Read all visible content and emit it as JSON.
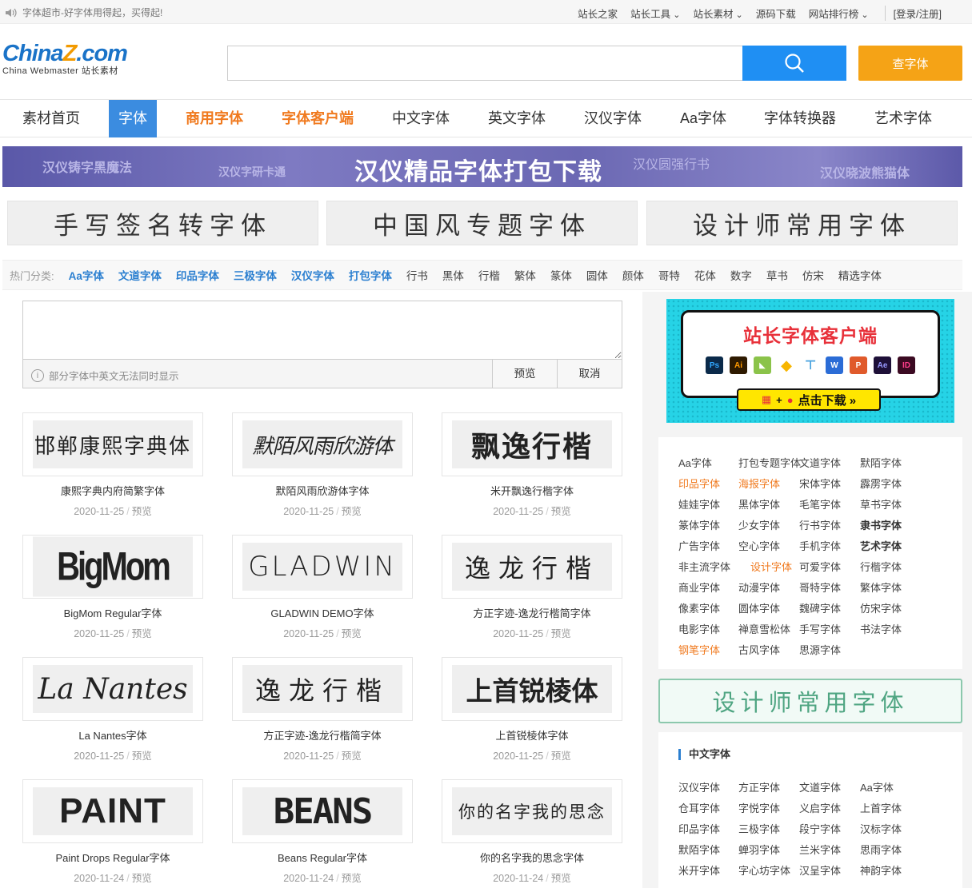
{
  "topbar": {
    "notice": "字体超市-好字体用得起，买得起!",
    "links": [
      "站长之家",
      "站长工具",
      "站长素材",
      "源码下载",
      "网站排行榜"
    ],
    "login": "[登录/注册]"
  },
  "logo": {
    "part1": "China",
    "part2": "Z",
    "part3": ".com",
    "subtitle": "China Webmaster 站长素材"
  },
  "search": {
    "value": "",
    "button": "查字体"
  },
  "nav": [
    "素材首页",
    "字体",
    "商用字体",
    "字体客户端",
    "中文字体",
    "英文字体",
    "汉仪字体",
    "Aa字体",
    "字体转换器",
    "艺术字体"
  ],
  "banner": {
    "main": "汉仪精品字体打包下载",
    "side_texts": [
      "汉仪铸字黑魔法",
      "汉仪字研卡通",
      "汉仪圆强行书",
      "汉仪晓波熊猫体"
    ]
  },
  "promos": [
    "手写签名转字体",
    "中国风专题字体",
    "设计师常用字体"
  ],
  "hot": {
    "label": "热门分类:",
    "blue": [
      "Aa字体",
      "文道字体",
      "印品字体",
      "三极字体",
      "汉仪字体",
      "打包字体"
    ],
    "plain": [
      "行书",
      "黑体",
      "行楷",
      "繁体",
      "篆体",
      "圆体",
      "颜体",
      "哥特",
      "花体",
      "数字",
      "草书",
      "仿宋",
      "精选字体"
    ]
  },
  "preview": {
    "hint": "部分字体中英文无法同时显示",
    "preview_btn": "预览",
    "cancel_btn": "取消"
  },
  "fonts": [
    {
      "sample": "邯郸康熙字典体",
      "name": "康熙字典内府简繁字体",
      "date": "2020-11-25",
      "action": "预览"
    },
    {
      "sample": "默陌风雨欣游体",
      "name": "默陌风雨欣游体字体",
      "date": "2020-11-25",
      "action": "预览"
    },
    {
      "sample": "飘逸行楷",
      "name": "米开飘逸行楷字体",
      "date": "2020-11-25",
      "action": "预览"
    },
    {
      "sample": "BigMom",
      "name": "BigMom Regular字体",
      "date": "2020-11-25",
      "action": "预览"
    },
    {
      "sample": "GLADWIN",
      "name": "GLADWIN DEMO字体",
      "date": "2020-11-25",
      "action": "预览"
    },
    {
      "sample": "逸龙行楷",
      "name": "方正字迹-逸龙行楷简字体",
      "date": "2020-11-25",
      "action": "预览"
    },
    {
      "sample": "La Nantes",
      "name": "La Nantes字体",
      "date": "2020-11-25",
      "action": "预览"
    },
    {
      "sample": "逸龙行楷",
      "name": "方正字迹-逸龙行楷简字体",
      "date": "2020-11-25",
      "action": "预览"
    },
    {
      "sample": "上首锐棱体",
      "name": "上首锐棱体字体",
      "date": "2020-11-25",
      "action": "预览"
    },
    {
      "sample": "PAINT",
      "name": "Paint Drops Regular字体",
      "date": "2020-11-24",
      "action": "预览"
    },
    {
      "sample": "BEANS",
      "name": "Beans Regular字体",
      "date": "2020-11-24",
      "action": "预览"
    },
    {
      "sample": "你的名字我的思念",
      "name": "你的名字我的思念字体",
      "date": "2020-11-24",
      "action": "预览"
    }
  ],
  "client_ad": {
    "title": "站长字体客户端",
    "apps": [
      "Ps",
      "Ai",
      "",
      "",
      "",
      "W",
      "P",
      "Ae",
      "ID"
    ],
    "download": "点击下载 »"
  },
  "tags": [
    [
      "Aa字体",
      "打包专题字体",
      "文道字体",
      "默陌字体"
    ],
    [
      "印品字体",
      "海报字体",
      "宋体字体",
      "霹雳字体"
    ],
    [
      "娃娃字体",
      "黑体字体",
      "毛笔字体",
      "草书字体"
    ],
    [
      "篆体字体",
      "少女字体",
      "行书字体",
      "隶书字体"
    ],
    [
      "广告字体",
      "空心字体",
      "手机字体",
      "艺术字体"
    ],
    [
      "非主流字体",
      "设计字体",
      "可爱字体",
      "行楷字体"
    ],
    [
      "商业字体",
      "动漫字体",
      "哥特字体",
      "繁体字体"
    ],
    [
      "像素字体",
      "圆体字体",
      "魏碑字体",
      "仿宋字体"
    ],
    [
      "电影字体",
      "禅意雪松体",
      "手写字体",
      "书法字体"
    ],
    [
      "钢笔字体",
      "古风字体",
      "思源字体"
    ]
  ],
  "designer_banner": "设计师常用字体",
  "cn_fonts": {
    "heading": "中文字体",
    "rows": [
      [
        "汉仪字体",
        "方正字体",
        "文道字体",
        "Aa字体"
      ],
      [
        "仓耳字体",
        "字悦字体",
        "义启字体",
        "上首字体"
      ],
      [
        "印品字体",
        "三极字体",
        "段宁字体",
        "汉标字体"
      ],
      [
        "默陌字体",
        "蝉羽字体",
        "兰米字体",
        "思雨字体"
      ],
      [
        "米开字体",
        "字心坊字体",
        "汉呈字体",
        "神韵字体"
      ]
    ]
  },
  "colors": {
    "blue": "#1f8ff3",
    "orange": "#f5a316",
    "accent_orange": "#f07a1f"
  }
}
